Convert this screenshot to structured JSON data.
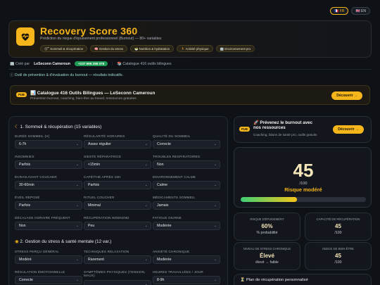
{
  "lang": {
    "fr": "🇫🇷 FR",
    "en": "🇬🇧 EN"
  },
  "header": {
    "title": "Recovery Score 360",
    "subtitle": "Prédiction du risque d'épuisement professionnel (Burnout) — 80+ variables",
    "chips": [
      "😴 Sommeil & récupération",
      "🧠 Gestion du stress",
      "🥗 Nutrition & hydratation",
      "🏃 Activité physique",
      "🏢 Environnement pro"
    ]
  },
  "meta": {
    "created_by": "🏢 Créé par",
    "brand": "LeSeconn Cameroun",
    "phone": "+237 699 298 078",
    "catalog": "📚 Catalogue 416 outils bilingues"
  },
  "notice": "ⓘ Outil de prévention & d'évaluation du burnout — résultats indicatifs.",
  "promo": {
    "badge": "PUB",
    "title": "📊 Catalogue 416 Outils Bilingues — LeSeconn Cameroun",
    "subtitle": "Prévention burnout, coaching, bien-être au travail, ressources gratuites",
    "button": "Découvrir →"
  },
  "promo2": {
    "badge": "PUB",
    "title": "🚀 Prévenez le burnout avec nos ressources",
    "subtitle": "Coaching, bilans de santé pro, outils gratuits",
    "button": "Découvrir →"
  },
  "section1": {
    "title": "1. Sommeil & récupération (15 variables)",
    "fields": [
      {
        "label": "Durée sommeil (h)",
        "value": "6-7h"
      },
      {
        "label": "Régularité horaires",
        "value": "Assez régulier"
      },
      {
        "label": "Qualité du sommeil",
        "value": "Correcte"
      },
      {
        "label": "Insomnies",
        "value": "Parfois"
      },
      {
        "label": "Sieste réparatrice",
        "value": "<15min"
      },
      {
        "label": "Troubles respiratoires",
        "value": "Non"
      },
      {
        "label": "Écran avant coucher",
        "value": "30-60min"
      },
      {
        "label": "Café/thé après 16h",
        "value": "Parfois"
      },
      {
        "label": "Environnement calme",
        "value": "Calme"
      },
      {
        "label": "Éveil reposé",
        "value": "Parfois"
      },
      {
        "label": "Rituel coucher",
        "value": "Minimal"
      },
      {
        "label": "Médicaments sommeil",
        "value": "Jamais"
      },
      {
        "label": "Décalage horaire fréquent",
        "value": "Non"
      },
      {
        "label": "Récupération weekend",
        "value": "Peu"
      },
      {
        "label": "Fatigue diurne",
        "value": "Modérée"
      }
    ]
  },
  "section2": {
    "title": "2. Gestion du stress & santé mentale (12 var.)",
    "fields": [
      {
        "label": "Stress perçu général",
        "value": "Modéré"
      },
      {
        "label": "Techniques relaxation",
        "value": "Rarement"
      },
      {
        "label": "Anxiété chronique",
        "value": "Modérée"
      },
      {
        "label": "Régulation émotionnelle",
        "value": "Correcte"
      },
      {
        "label": "Symptômes physiques (tension, maux)",
        "value": ""
      },
      {
        "label": "Heures travaillées / jour",
        "value": "8-9h"
      }
    ]
  },
  "score": {
    "value": "45",
    "max": "/100",
    "risk": "Risque modéré",
    "fill": 0.45
  },
  "stats": [
    {
      "k": "Risque d'épuisement",
      "v": "60%",
      "u": "% probabilité"
    },
    {
      "k": "Capacité de récupération",
      "v": "45",
      "u": "/100"
    },
    {
      "k": "Niveau de stress chronique",
      "v": "Élevé",
      "u": "élevé → faible"
    },
    {
      "k": "Indice de bien-être",
      "v": "45",
      "u": "/100"
    }
  ],
  "plan": {
    "title": "⏳ Plan de récupération personnalisé"
  },
  "colors": {
    "accent": "#f5b51b",
    "background": "#0e1116",
    "success": "#1f9d55"
  }
}
